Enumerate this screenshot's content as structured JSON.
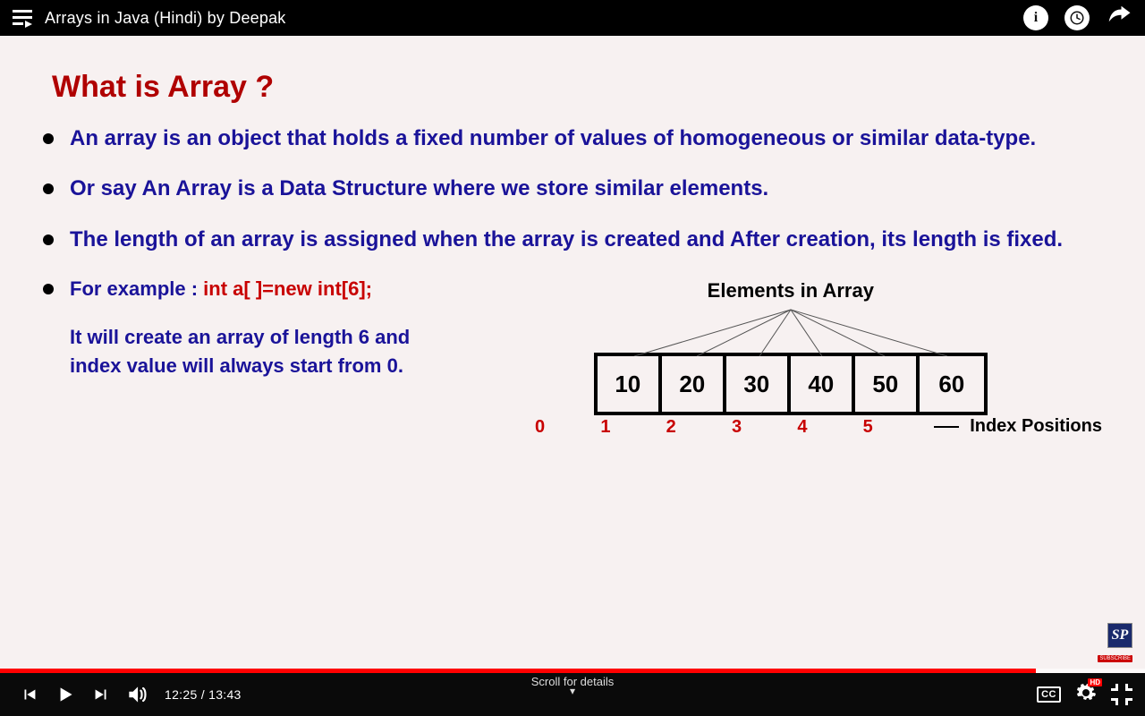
{
  "video": {
    "title": "Arrays in Java (Hindi) by Deepak",
    "current_time": "12:25",
    "duration": "13:43",
    "time_display": "12:25 / 13:43",
    "scroll_hint": "Scroll for details",
    "cc_label": "CC",
    "hd_label": "HD",
    "info_label": "i"
  },
  "slide": {
    "heading": "What is Array ?",
    "bullets": [
      "An array is an object that holds a fixed number of values of homogeneous or similar data-type.",
      "Or say An Array is a Data Structure where we store similar elements.",
      "The length of an array is assigned when the array is created and After creation, its length is fixed."
    ],
    "example_label": "For example : ",
    "example_code": "int a[ ]=new int[6];",
    "example_explain": "It will create an array of length 6 and index value will always start from 0.",
    "elements_label": "Elements in Array",
    "array_values": [
      "10",
      "20",
      "30",
      "40",
      "50",
      "60"
    ],
    "index_values": [
      "0",
      "1",
      "2",
      "3",
      "4",
      "5"
    ],
    "index_label": "Index Positions",
    "logo_text": "SP",
    "subscribe_text": "SUBSCRIBE"
  }
}
